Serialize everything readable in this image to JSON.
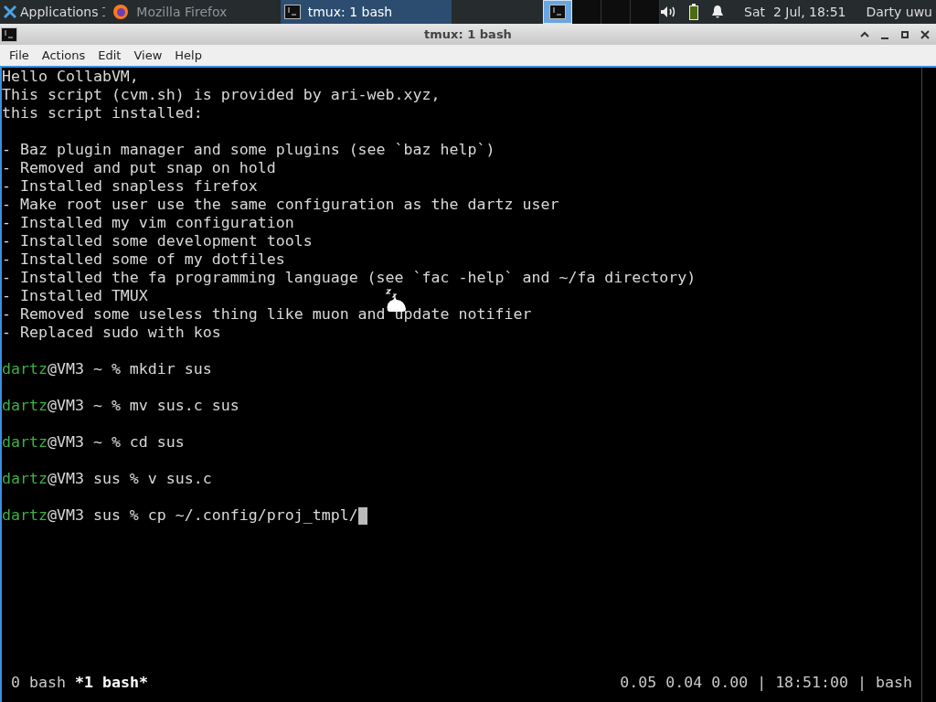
{
  "panel": {
    "apps_menu": "Applications",
    "tasks": [
      {
        "title": "Mozilla Firefox",
        "kind": "browser",
        "selected": false
      },
      {
        "title": "tmux: 1 bash",
        "kind": "terminal",
        "selected": true
      }
    ],
    "workspaces": [
      {
        "selected": true
      },
      {
        "selected": false
      },
      {
        "selected": false
      },
      {
        "selected": false
      }
    ],
    "clock": "Sat  2 Jul, 18:51",
    "user": "Darty uwu"
  },
  "window": {
    "title": "tmux: 1 bash",
    "menu": [
      "File",
      "Actions",
      "Edit",
      "View",
      "Help"
    ],
    "terminal": {
      "lines": [
        {
          "kind": "text",
          "text": "Hello CollabVM,"
        },
        {
          "kind": "text",
          "text": "This script (cvm.sh) is provided by ari-web.xyz,"
        },
        {
          "kind": "text",
          "text": "this script installed:"
        },
        {
          "kind": "blank"
        },
        {
          "kind": "text",
          "text": "- Baz plugin manager and some plugins (see `baz help`)"
        },
        {
          "kind": "text",
          "text": "- Removed and put snap on hold"
        },
        {
          "kind": "text",
          "text": "- Installed snapless firefox"
        },
        {
          "kind": "text",
          "text": "- Make root user use the same configuration as the dartz user"
        },
        {
          "kind": "text",
          "text": "- Installed my vim configuration"
        },
        {
          "kind": "text",
          "text": "- Installed some development tools"
        },
        {
          "kind": "text",
          "text": "- Installed some of my dotfiles"
        },
        {
          "kind": "text",
          "text": "- Installed the fa programming language (see `fac -help` and ~/fa directory)"
        },
        {
          "kind": "text",
          "text": "- Installed TMUX"
        },
        {
          "kind": "text",
          "text": "- Removed some useless thing like muon and update notifier"
        },
        {
          "kind": "text",
          "text": "- Replaced sudo with kos"
        },
        {
          "kind": "blank"
        },
        {
          "kind": "prompt",
          "user": "dartz",
          "rest": "@VM3 ~ % mkdir sus",
          "cursor": false
        },
        {
          "kind": "blank"
        },
        {
          "kind": "prompt",
          "user": "dartz",
          "rest": "@VM3 ~ % mv sus.c sus",
          "cursor": false
        },
        {
          "kind": "blank"
        },
        {
          "kind": "prompt",
          "user": "dartz",
          "rest": "@VM3 ~ % cd sus",
          "cursor": false
        },
        {
          "kind": "blank"
        },
        {
          "kind": "prompt",
          "user": "dartz",
          "rest": "@VM3 sus % v sus.c",
          "cursor": false
        },
        {
          "kind": "blank"
        },
        {
          "kind": "prompt",
          "user": "dartz",
          "rest": "@VM3 sus % cp ~/.config/proj_tmpl/",
          "cursor": true
        }
      ],
      "status": {
        "windows": [
          {
            "label": "0 bash",
            "selected": false
          },
          {
            "label": "*1 bash*",
            "selected": true
          }
        ],
        "right": "0.05 0.04 0.00 | 18:51:00 | bash"
      }
    }
  }
}
